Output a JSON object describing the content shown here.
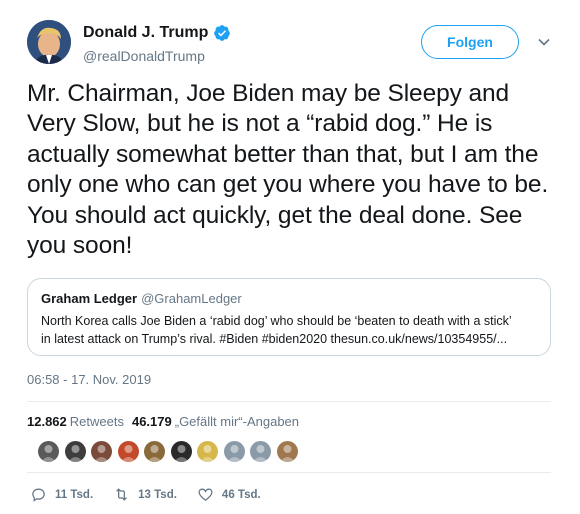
{
  "author": {
    "display_name": "Donald J. Trump",
    "handle": "@realDonaldTrump",
    "verified": true
  },
  "follow_label": "Folgen",
  "tweet_text": "Mr. Chairman, Joe Biden may be Sleepy and Very Slow, but he is not a “rabid dog.” He is actually somewhat better than that, but I am the only one who can get you where you have to be. You should act quickly, get the deal done. See you soon!",
  "quote": {
    "name": "Graham Ledger",
    "handle": "@GrahamLedger",
    "line1": "North Korea calls Joe Biden a ‘rabid dog’ who should be ‘beaten to death with a stick’",
    "line2": "in latest attack on Trump’s rival. #Biden #biden2020  thesun.co.uk/news/10354955/..."
  },
  "timestamp": "06:58 - 17. Nov. 2019",
  "stats": {
    "retweets_count": "12.862",
    "retweets_label": "Retweets",
    "likes_count": "46.179",
    "likes_label": "„Gefällt mir“-Angaben"
  },
  "liker_avatars": [
    "#5a5a5a",
    "#3d3d3d",
    "#7a4a3a",
    "#c24a2a",
    "#8a6a3a",
    "#2a2a2a",
    "#d6b84a",
    "#8a9aa8",
    "#8a9aa8",
    "#a07850"
  ],
  "actions": {
    "replies": "11 Tsd.",
    "retweets": "13 Tsd.",
    "likes": "46 Tsd."
  },
  "colors": {
    "accent": "#1da1f2",
    "muted": "#657786",
    "border": "#ccd6dd"
  },
  "icons": [
    "verified-badge-icon",
    "chevron-down-icon",
    "reply-icon",
    "retweet-icon",
    "heart-icon"
  ]
}
